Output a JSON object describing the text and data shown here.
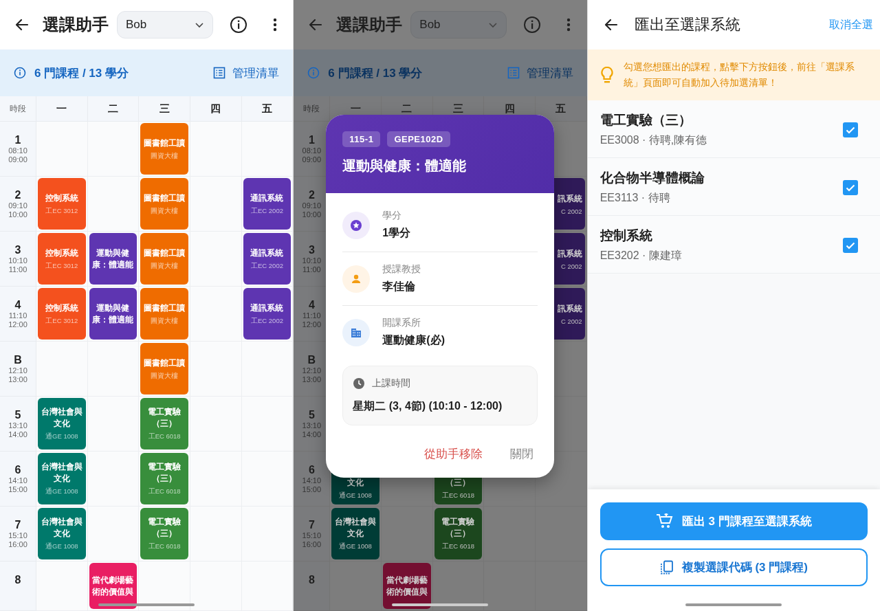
{
  "schedule": {
    "header": {
      "title": "選課助手",
      "user": "Bob"
    },
    "summary": {
      "text": "6 門課程 / 13 學分",
      "action": "管理清單"
    },
    "timetable": {
      "period_header": "時段",
      "days": [
        "一",
        "二",
        "三",
        "四",
        "五"
      ],
      "periods": [
        {
          "label": "1",
          "start": "08:10",
          "end": "09:00",
          "cells": [
            {
              "kind": "empty"
            },
            {
              "kind": "empty"
            },
            {
              "kind": "course",
              "title": "圖書館工讀",
              "room": "圖資大樓",
              "color": "#ef6c00"
            },
            {
              "kind": "empty"
            },
            {
              "kind": "empty"
            }
          ]
        },
        {
          "label": "2",
          "start": "09:10",
          "end": "10:00",
          "cells": [
            {
              "kind": "course",
              "title": "控制系統",
              "room": "工EC 3012",
              "color": "#f4511e"
            },
            {
              "kind": "empty"
            },
            {
              "kind": "course",
              "title": "圖書館工讀",
              "room": "圖資大樓",
              "color": "#ef6c00"
            },
            {
              "kind": "empty"
            },
            {
              "kind": "course",
              "title": "通訊系統",
              "room": "工EC 2002",
              "color": "#5e35b1"
            }
          ]
        },
        {
          "label": "3",
          "start": "10:10",
          "end": "11:00",
          "cells": [
            {
              "kind": "course",
              "title": "控制系統",
              "room": "工EC 3012",
              "color": "#f4511e"
            },
            {
              "kind": "course",
              "title": "運動與健康：體適能",
              "color": "#5e35b1"
            },
            {
              "kind": "course",
              "title": "圖書館工讀",
              "room": "圖資大樓",
              "color": "#ef6c00"
            },
            {
              "kind": "empty"
            },
            {
              "kind": "course",
              "title": "通訊系統",
              "room": "工EC 2002",
              "color": "#5e35b1"
            }
          ]
        },
        {
          "label": "4",
          "start": "11:10",
          "end": "12:00",
          "cells": [
            {
              "kind": "course",
              "title": "控制系統",
              "room": "工EC 3012",
              "color": "#f4511e"
            },
            {
              "kind": "course",
              "title": "運動與健康：體適能",
              "color": "#5e35b1"
            },
            {
              "kind": "course",
              "title": "圖書館工讀",
              "room": "圖資大樓",
              "color": "#ef6c00"
            },
            {
              "kind": "empty"
            },
            {
              "kind": "course",
              "title": "通訊系統",
              "room": "工EC 2002",
              "color": "#5e35b1"
            }
          ]
        },
        {
          "label": "B",
          "start": "12:10",
          "end": "13:00",
          "cells": [
            {
              "kind": "empty"
            },
            {
              "kind": "empty"
            },
            {
              "kind": "course",
              "title": "圖書館工讀",
              "room": "圖資大樓",
              "color": "#ef6c00"
            },
            {
              "kind": "empty"
            },
            {
              "kind": "empty"
            }
          ]
        },
        {
          "label": "5",
          "start": "13:10",
          "end": "14:00",
          "cells": [
            {
              "kind": "course",
              "title": "台灣社會與文化",
              "room": "通GE 1008",
              "color": "#00796b"
            },
            {
              "kind": "empty"
            },
            {
              "kind": "course",
              "title": "電工實驗（三）",
              "room": "工EC 6018",
              "color": "#388e3c"
            },
            {
              "kind": "empty"
            },
            {
              "kind": "empty"
            }
          ]
        },
        {
          "label": "6",
          "start": "14:10",
          "end": "15:00",
          "cells": [
            {
              "kind": "course",
              "title": "台灣社會與文化",
              "room": "通GE 1008",
              "color": "#00796b"
            },
            {
              "kind": "empty"
            },
            {
              "kind": "course",
              "title": "電工實驗（三）",
              "room": "工EC 6018",
              "color": "#388e3c"
            },
            {
              "kind": "empty"
            },
            {
              "kind": "empty"
            }
          ]
        },
        {
          "label": "7",
          "start": "15:10",
          "end": "16:00",
          "cells": [
            {
              "kind": "course",
              "title": "台灣社會與文化",
              "room": "通GE 1008",
              "color": "#00796b"
            },
            {
              "kind": "empty"
            },
            {
              "kind": "course",
              "title": "電工實驗（三）",
              "room": "工EC 6018",
              "color": "#388e3c"
            },
            {
              "kind": "empty"
            },
            {
              "kind": "empty"
            }
          ]
        },
        {
          "label": "8",
          "cells": [
            {
              "kind": "empty"
            },
            {
              "kind": "course",
              "title": "當代劇場藝術的價值與",
              "color": "#e91e63"
            },
            {
              "kind": "empty"
            },
            {
              "kind": "empty"
            },
            {
              "kind": "empty"
            }
          ]
        }
      ]
    }
  },
  "detail": {
    "header": {
      "title": "選課助手",
      "user": "Bob"
    },
    "summary": {
      "text": "6 門課程 / 13 學分",
      "action": "管理清單"
    },
    "timetable": {
      "period_header": "時段",
      "days": [
        "一",
        "二",
        "三",
        "四",
        "五"
      ],
      "periods": [
        {
          "label": "1",
          "start": "08:10",
          "end": "09:00",
          "cells": [
            {
              "kind": "covered"
            },
            {
              "kind": "covered"
            },
            {
              "kind": "covered"
            },
            {
              "kind": "covered"
            },
            {
              "kind": "empty"
            }
          ]
        },
        {
          "label": "2",
          "start": "09:10",
          "end": "10:00",
          "cells": [
            {
              "kind": "covered"
            },
            {
              "kind": "covered"
            },
            {
              "kind": "covered"
            },
            {
              "kind": "covered"
            },
            {
              "kind": "right",
              "title": "訊系統",
              "room": "C 2002",
              "color": "#2f1a58"
            }
          ]
        },
        {
          "label": "3",
          "start": "10:10",
          "end": "11:00",
          "cells": [
            {
              "kind": "covered"
            },
            {
              "kind": "covered"
            },
            {
              "kind": "covered"
            },
            {
              "kind": "covered"
            },
            {
              "kind": "right",
              "title": "訊系統",
              "room": "C 2002",
              "color": "#2f1a58"
            }
          ]
        },
        {
          "label": "4",
          "start": "11:10",
          "end": "12:00",
          "cells": [
            {
              "kind": "covered"
            },
            {
              "kind": "covered"
            },
            {
              "kind": "covered"
            },
            {
              "kind": "covered"
            },
            {
              "kind": "right",
              "title": "訊系統",
              "room": "C 2002",
              "color": "#2f1a58"
            }
          ]
        },
        {
          "label": "B",
          "start": "12:10",
          "end": "13:00",
          "cells": [
            {
              "kind": "covered"
            },
            {
              "kind": "covered"
            },
            {
              "kind": "covered"
            },
            {
              "kind": "covered"
            },
            {
              "kind": "empty"
            }
          ]
        },
        {
          "label": "5",
          "start": "13:10",
          "end": "14:00",
          "cells": [
            {
              "kind": "covered"
            },
            {
              "kind": "covered"
            },
            {
              "kind": "covered"
            },
            {
              "kind": "covered"
            },
            {
              "kind": "empty"
            }
          ]
        },
        {
          "label": "6",
          "start": "14:10",
          "end": "15:00",
          "cells": [
            {
              "kind": "bottom",
              "title": "文化",
              "room": "通GE 1008",
              "color": "#003c36"
            },
            {
              "kind": "empty"
            },
            {
              "kind": "bottom",
              "title": "（三）",
              "room": "工EC 6018",
              "color": "#1c471e"
            },
            {
              "kind": "empty"
            },
            {
              "kind": "empty"
            }
          ]
        },
        {
          "label": "7",
          "start": "15:10",
          "end": "16:00",
          "cells": [
            {
              "kind": "course",
              "title": "台灣社會與文化",
              "room": "通GE 1008",
              "color": "#003c36"
            },
            {
              "kind": "empty"
            },
            {
              "kind": "course",
              "title": "電工實驗（三）",
              "room": "工EC 6018",
              "color": "#1c471e"
            },
            {
              "kind": "empty"
            },
            {
              "kind": "empty"
            }
          ]
        },
        {
          "label": "8",
          "cells": [
            {
              "kind": "empty"
            },
            {
              "kind": "course",
              "title": "當代劇場藝術的價值與",
              "color": "#740f31"
            },
            {
              "kind": "empty"
            },
            {
              "kind": "empty"
            },
            {
              "kind": "empty"
            }
          ]
        }
      ]
    },
    "dialog": {
      "chips": [
        "115-1",
        "GEPE102D"
      ],
      "title": "運動與健康：體適能",
      "fields": [
        {
          "kind": "credits",
          "label": "學分",
          "value": "1學分"
        },
        {
          "kind": "teacher",
          "label": "授課教授",
          "value": "李佳倫"
        },
        {
          "kind": "department",
          "label": "開課系所",
          "value": "運動健康(必)"
        }
      ],
      "time": {
        "label": "上課時間",
        "value": "星期二 (3, 4節) (10:10 - 12:00)"
      },
      "actions": [
        {
          "kind": "danger",
          "label": "從助手移除"
        },
        {
          "kind": "plain",
          "label": "關閉"
        }
      ]
    }
  },
  "export": {
    "header": {
      "title": "匯出至選課系統",
      "action": "取消全選"
    },
    "hint": "勾選您想匯出的課程，點擊下方按鈕後，前往「選課系統」頁面即可自動加入待加選清單！",
    "courses": [
      {
        "name": "電工實驗（三）",
        "meta": "EE3008 · 待聘,陳有德",
        "checked": true
      },
      {
        "name": "化合物半導體概論",
        "meta": "EE3113 · 待聘",
        "checked": true
      },
      {
        "name": "控制系統",
        "meta": "EE3202 · 陳建璋",
        "checked": true
      }
    ],
    "primary_button": "匯出 3 門課程至選課系統",
    "secondary_button": "複製選課代碼 (3 門課程)"
  }
}
